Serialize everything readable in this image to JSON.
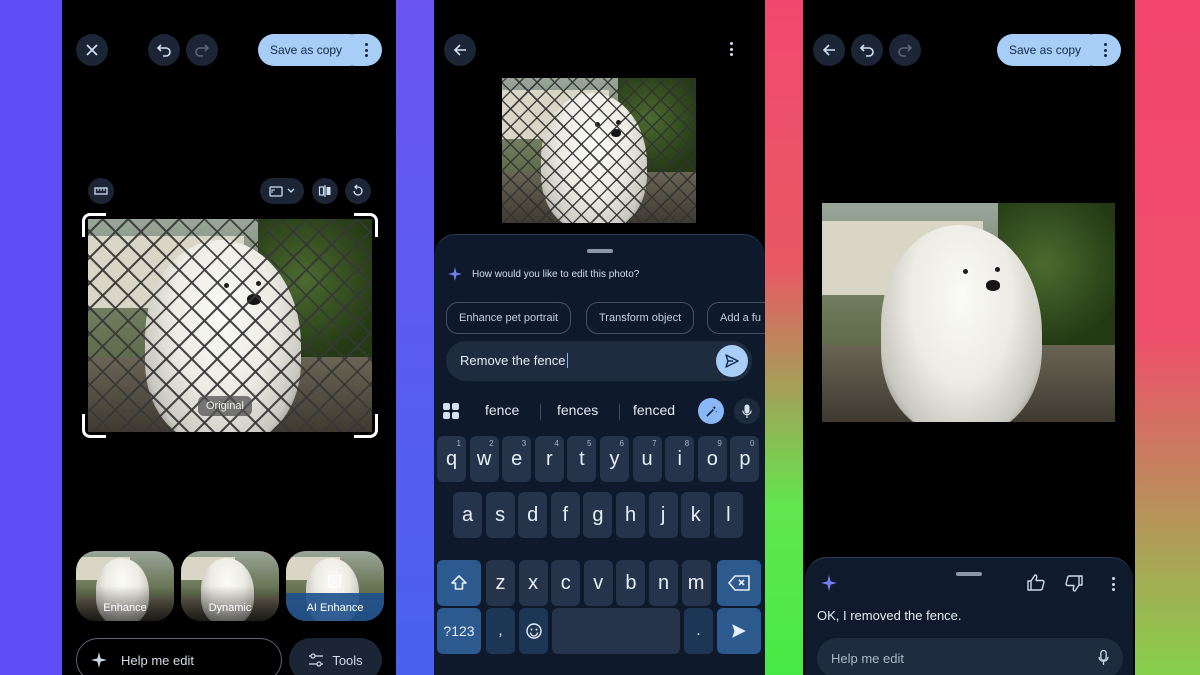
{
  "colors": {
    "accent": "#a8cdf7",
    "panel_bg": "#000000",
    "sheet_bg": "#0e1a2b"
  },
  "panel1": {
    "save_label": "Save as copy",
    "original_tag": "Original",
    "filters": [
      {
        "label": "Enhance"
      },
      {
        "label": "Dynamic"
      },
      {
        "label": "AI Enhance"
      }
    ],
    "help_me_edit": "Help me edit",
    "tools_label": "Tools"
  },
  "panel2": {
    "prompt_question": "How would you like to edit this photo?",
    "chips": [
      "Enhance pet portrait",
      "Transform object",
      "Add a fu"
    ],
    "input_value": "Remove the fence",
    "suggestions": [
      "fence",
      "fences",
      "fenced"
    ],
    "keyboard": {
      "row1": [
        {
          "k": "q",
          "n": "1"
        },
        {
          "k": "w",
          "n": "2"
        },
        {
          "k": "e",
          "n": "3"
        },
        {
          "k": "r",
          "n": "4"
        },
        {
          "k": "t",
          "n": "5"
        },
        {
          "k": "y",
          "n": "6"
        },
        {
          "k": "u",
          "n": "7"
        },
        {
          "k": "i",
          "n": "8"
        },
        {
          "k": "o",
          "n": "9"
        },
        {
          "k": "p",
          "n": "0"
        }
      ],
      "row2": [
        "a",
        "s",
        "d",
        "f",
        "g",
        "h",
        "j",
        "k",
        "l"
      ],
      "row3": [
        "z",
        "x",
        "c",
        "v",
        "b",
        "n",
        "m"
      ],
      "sym_label": "?123",
      "comma": ",",
      "period": "."
    }
  },
  "panel3": {
    "save_label": "Save as copy",
    "reply_text": "OK, I removed the fence.",
    "help_placeholder": "Help me edit"
  }
}
